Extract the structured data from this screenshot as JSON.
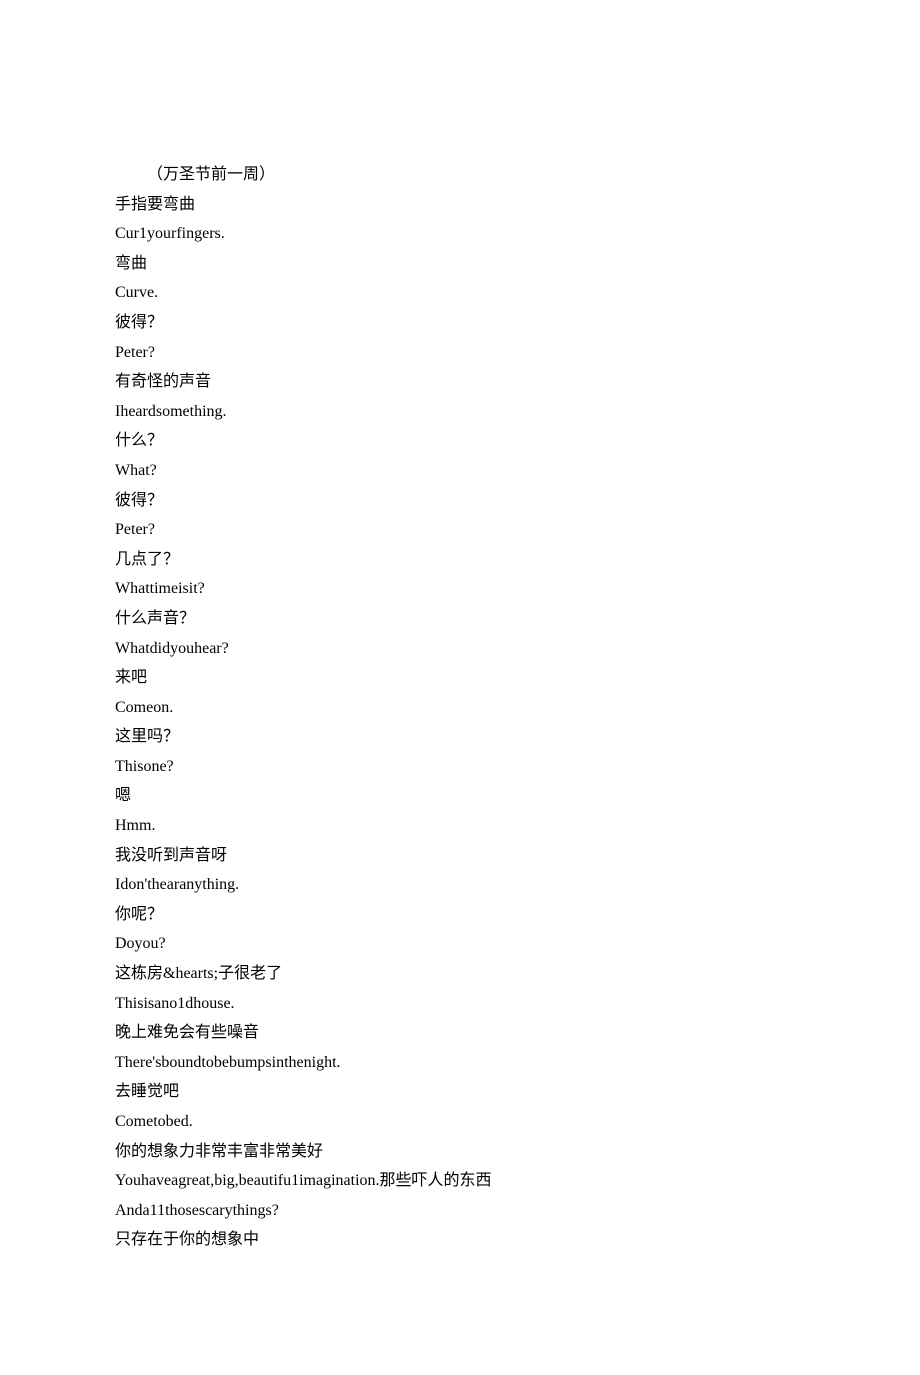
{
  "lines": [
    "（万圣节前一周）",
    "手指要弯曲",
    "Cur1yourfingers.",
    "弯曲",
    "Curve.",
    "彼得？",
    "Peter?",
    "有奇怪的声音",
    "Iheardsomething.",
    "什么？",
    "What?",
    "彼得？",
    "Peter?",
    "几点了？",
    "Whattimeisit?",
    "什么声音？",
    "Whatdidyouhear?",
    "来吧",
    "Comeon.",
    "这里吗？",
    "Thisone?",
    "嗯",
    "Hmm.",
    "我没听到声音呀",
    "Idon'thearanything.",
    "你呢？",
    "Doyou?",
    "这栋房&hearts;子很老了",
    "Thisisano1dhouse.",
    "晚上难免会有些噪音",
    "There'sboundtobebumpsinthenight.",
    "去睡觉吧",
    "Cometobed.",
    "你的想象力非常丰富非常美好",
    "Youhaveagreat,big,beautifu1imagination.那些吓人的东西",
    "Anda11thosescarythings?",
    "只存在于你的想象中"
  ]
}
